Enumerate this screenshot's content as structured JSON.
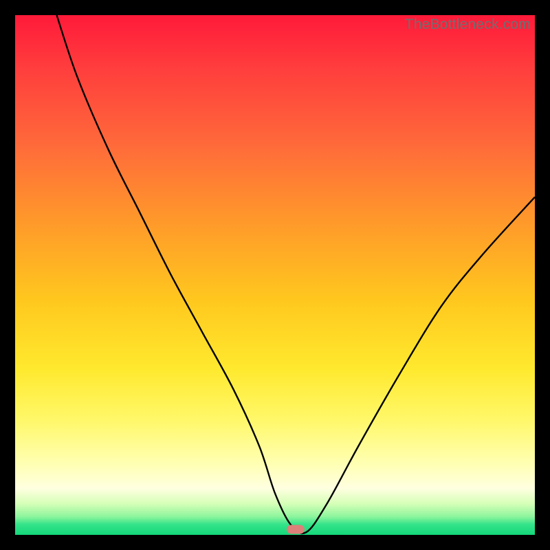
{
  "watermark": "TheBottleneck.com",
  "marker": {
    "x_pct": 54.0,
    "y_pct": 99.0,
    "color": "#dd8079"
  },
  "chart_data": {
    "type": "line",
    "title": "",
    "xlabel": "",
    "ylabel": "",
    "xlim": [
      0,
      100
    ],
    "ylim": [
      0,
      100
    ],
    "grid": false,
    "series": [
      {
        "name": "curve",
        "x": [
          8,
          12,
          18,
          24,
          30,
          36,
          42,
          47,
          50,
          53,
          56,
          60,
          66,
          74,
          82,
          90,
          100
        ],
        "y": [
          100,
          88,
          74,
          62,
          50,
          39,
          28,
          17,
          8,
          2,
          0.5,
          6,
          17,
          31,
          44,
          54,
          65
        ]
      }
    ],
    "annotations": [
      {
        "text": "TheBottleneck.com",
        "position": "top-right"
      }
    ]
  }
}
